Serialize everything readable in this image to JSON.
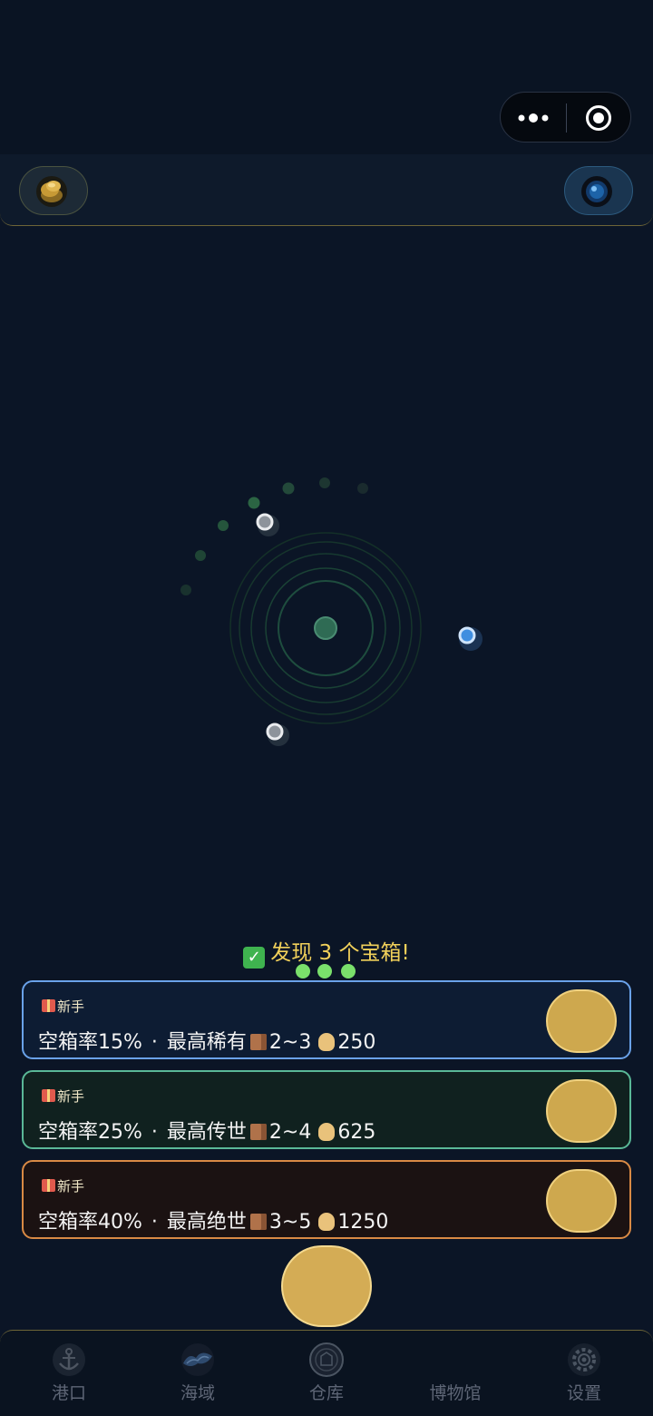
{
  "status_area": {},
  "top_bar": {
    "left_icon": "gold-coins-icon",
    "right_icon": "blue-orb-icon"
  },
  "radar": {
    "center_icon": "radar-center-icon",
    "markers": [
      "white-marker",
      "blue-marker",
      "white-marker"
    ]
  },
  "found_message": "发现 3 个宝箱!",
  "cards": [
    {
      "tag": "新手",
      "empty_rate": "空箱率15%",
      "separator": "·",
      "max_rarity": "最高稀有",
      "box_count": "2~3",
      "cost": "250",
      "border_color": "#6aa2e9"
    },
    {
      "tag": "新手",
      "empty_rate": "空箱率25%",
      "separator": "·",
      "max_rarity": "最高传世",
      "box_count": "2~4",
      "cost": "625",
      "border_color": "#5ab897"
    },
    {
      "tag": "新手",
      "empty_rate": "空箱率40%",
      "separator": "·",
      "max_rarity": "最高绝世",
      "box_count": "3~5",
      "cost": "1250",
      "border_color": "#d98a45"
    }
  ],
  "tabs": [
    {
      "label": "港口",
      "icon": "anchor-icon"
    },
    {
      "label": "海域",
      "icon": "sea-icon"
    },
    {
      "label": "仓库",
      "icon": "warehouse-icon"
    },
    {
      "label": "博物馆",
      "icon": "museum-icon"
    },
    {
      "label": "设置",
      "icon": "gear-icon"
    }
  ],
  "colors": {
    "accent_gold": "#cea84e",
    "found_text": "#f1d05a",
    "pager_green": "#7ae06b"
  }
}
